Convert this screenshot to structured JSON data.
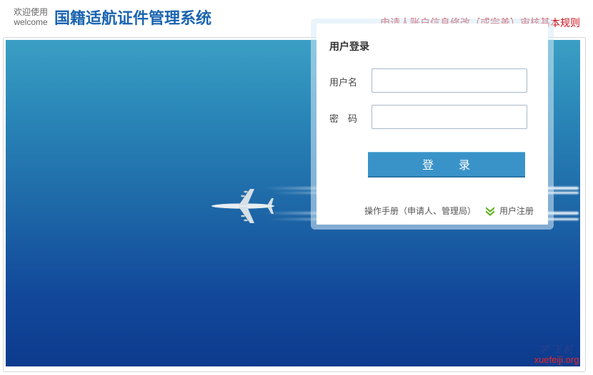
{
  "header": {
    "welcome_line1": "欢迎使用",
    "welcome_line2": "welcome",
    "system_title": "国籍适航证件管理系统",
    "rules_link": "申请人账户信息修改（或完善）审核基本规则"
  },
  "login": {
    "title": "用户登录",
    "username_label": "用户名",
    "username_value": "",
    "password_label": "密　码",
    "password_value": "",
    "submit_label": "登　　录",
    "manual_link": "操作手册（申请人、管理局）",
    "register_link": "用户注册"
  },
  "watermark": {
    "line1": "学飞机",
    "line2": "xuefeiji.org"
  },
  "colors": {
    "title_blue": "#1a64b0",
    "rules_red": "#c8101a",
    "button_blue": "#3a93c8",
    "register_icon_green": "#6ab42d"
  },
  "icons": {
    "register": "green-double-chevron-down-icon"
  }
}
